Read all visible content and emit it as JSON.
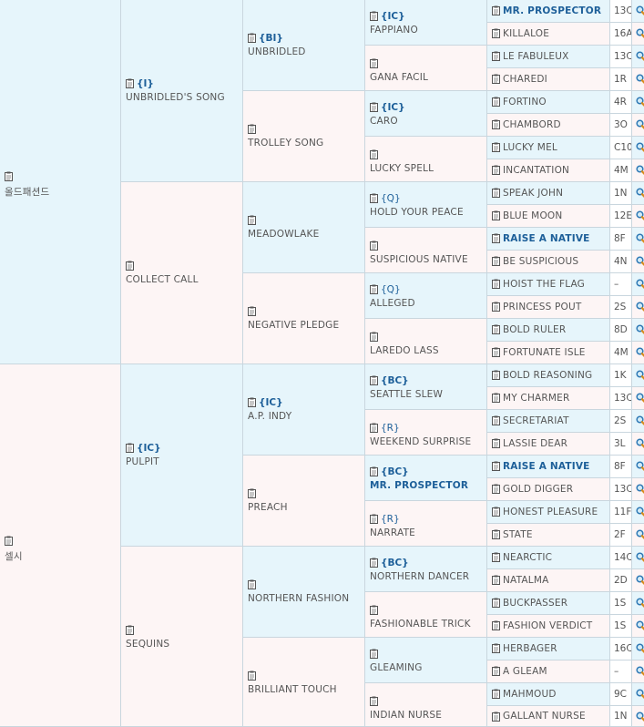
{
  "gen1": [
    {
      "name": "올드패션드",
      "code": ""
    },
    {
      "name": "셀시",
      "code": ""
    }
  ],
  "gen2": [
    {
      "name": "UNBRIDLED'S SONG",
      "code": "{I}"
    },
    {
      "name": "COLLECT CALL",
      "code": ""
    },
    {
      "name": "PULPIT",
      "code": "{IC}"
    },
    {
      "name": "SEQUINS",
      "code": ""
    }
  ],
  "gen3": [
    {
      "name": "UNBRIDLED",
      "code": "{BI}"
    },
    {
      "name": "TROLLEY SONG",
      "code": ""
    },
    {
      "name": "MEADOWLAKE",
      "code": ""
    },
    {
      "name": "NEGATIVE PLEDGE",
      "code": ""
    },
    {
      "name": "A.P. INDY",
      "code": "{IC}"
    },
    {
      "name": "PREACH",
      "code": ""
    },
    {
      "name": "NORTHERN FASHION",
      "code": ""
    },
    {
      "name": "BRILLIANT TOUCH",
      "code": ""
    }
  ],
  "gen4": [
    {
      "name": "FAPPIANO",
      "code": "{IC}",
      "bold": false
    },
    {
      "name": "GANA FACIL",
      "code": "",
      "bold": false
    },
    {
      "name": "CARO",
      "code": "{IC}",
      "bold": false
    },
    {
      "name": "LUCKY SPELL",
      "code": "",
      "bold": false
    },
    {
      "name": "HOLD YOUR PEACE",
      "code": "{Q}",
      "bold": false
    },
    {
      "name": "SUSPICIOUS NATIVE",
      "code": "",
      "bold": false
    },
    {
      "name": "ALLEGED",
      "code": "{Q}",
      "bold": false
    },
    {
      "name": "LAREDO LASS",
      "code": "",
      "bold": false
    },
    {
      "name": "SEATTLE SLEW",
      "code": "{BC}",
      "bold": false
    },
    {
      "name": "WEEKEND SURPRISE",
      "code": "{R}",
      "bold": false
    },
    {
      "name": "MR. PROSPECTOR",
      "code": "{BC}",
      "bold": true
    },
    {
      "name": "NARRATE",
      "code": "{R}",
      "bold": false
    },
    {
      "name": "NORTHERN DANCER",
      "code": "{BC}",
      "bold": false
    },
    {
      "name": "FASHIONABLE TRICK",
      "code": "",
      "bold": false
    },
    {
      "name": "GLEAMING",
      "code": "",
      "bold": false
    },
    {
      "name": "INDIAN NURSE",
      "code": "",
      "bold": false
    }
  ],
  "gen5": [
    {
      "name": "MR. PROSPECTOR",
      "code": "13C",
      "bold": true
    },
    {
      "name": "KILLALOE",
      "code": "16A",
      "bold": false
    },
    {
      "name": "LE FABULEUX",
      "code": "13C",
      "bold": false
    },
    {
      "name": "CHAREDI",
      "code": "1R",
      "bold": false
    },
    {
      "name": "FORTINO",
      "code": "4R",
      "bold": false
    },
    {
      "name": "CHAMBORD",
      "code": "3O",
      "bold": false
    },
    {
      "name": "LUCKY MEL",
      "code": "C10",
      "bold": false
    },
    {
      "name": "INCANTATION",
      "code": "4M",
      "bold": false
    },
    {
      "name": "SPEAK JOHN",
      "code": "1N",
      "bold": false
    },
    {
      "name": "BLUE MOON",
      "code": "12E",
      "bold": false
    },
    {
      "name": "RAISE A NATIVE",
      "code": "8F",
      "bold": true
    },
    {
      "name": "BE SUSPICIOUS",
      "code": "4N",
      "bold": false
    },
    {
      "name": "HOIST THE FLAG",
      "code": "–",
      "bold": false
    },
    {
      "name": "PRINCESS POUT",
      "code": "2S",
      "bold": false
    },
    {
      "name": "BOLD RULER",
      "code": "8D",
      "bold": false
    },
    {
      "name": "FORTUNATE ISLE",
      "code": "4M",
      "bold": false
    },
    {
      "name": "BOLD REASONING",
      "code": "1K",
      "bold": false
    },
    {
      "name": "MY CHARMER",
      "code": "13C",
      "bold": false
    },
    {
      "name": "SECRETARIAT",
      "code": "2S",
      "bold": false
    },
    {
      "name": "LASSIE DEAR",
      "code": "3L",
      "bold": false
    },
    {
      "name": "RAISE A NATIVE",
      "code": "8F",
      "bold": true
    },
    {
      "name": "GOLD DIGGER",
      "code": "13C",
      "bold": false
    },
    {
      "name": "HONEST PLEASURE",
      "code": "11F",
      "bold": false
    },
    {
      "name": "STATE",
      "code": "2F",
      "bold": false
    },
    {
      "name": "NEARCTIC",
      "code": "14C",
      "bold": false
    },
    {
      "name": "NATALMA",
      "code": "2D",
      "bold": false
    },
    {
      "name": "BUCKPASSER",
      "code": "1S",
      "bold": false
    },
    {
      "name": "FASHION VERDICT",
      "code": "1S",
      "bold": false
    },
    {
      "name": "HERBAGER",
      "code": "16C",
      "bold": false
    },
    {
      "name": "A GLEAM",
      "code": "–",
      "bold": false
    },
    {
      "name": "MAHMOUD",
      "code": "9C",
      "bold": false
    },
    {
      "name": "GALLANT NURSE",
      "code": "1N",
      "bold": false
    }
  ],
  "colors": {
    "blue_cell": "#e6f5fb",
    "pink_cell": "#fdf5f5",
    "link": "#1d5f99",
    "border": "#c9d6de"
  },
  "icons": {
    "document": "document-icon",
    "search": "magnifier-icon"
  }
}
